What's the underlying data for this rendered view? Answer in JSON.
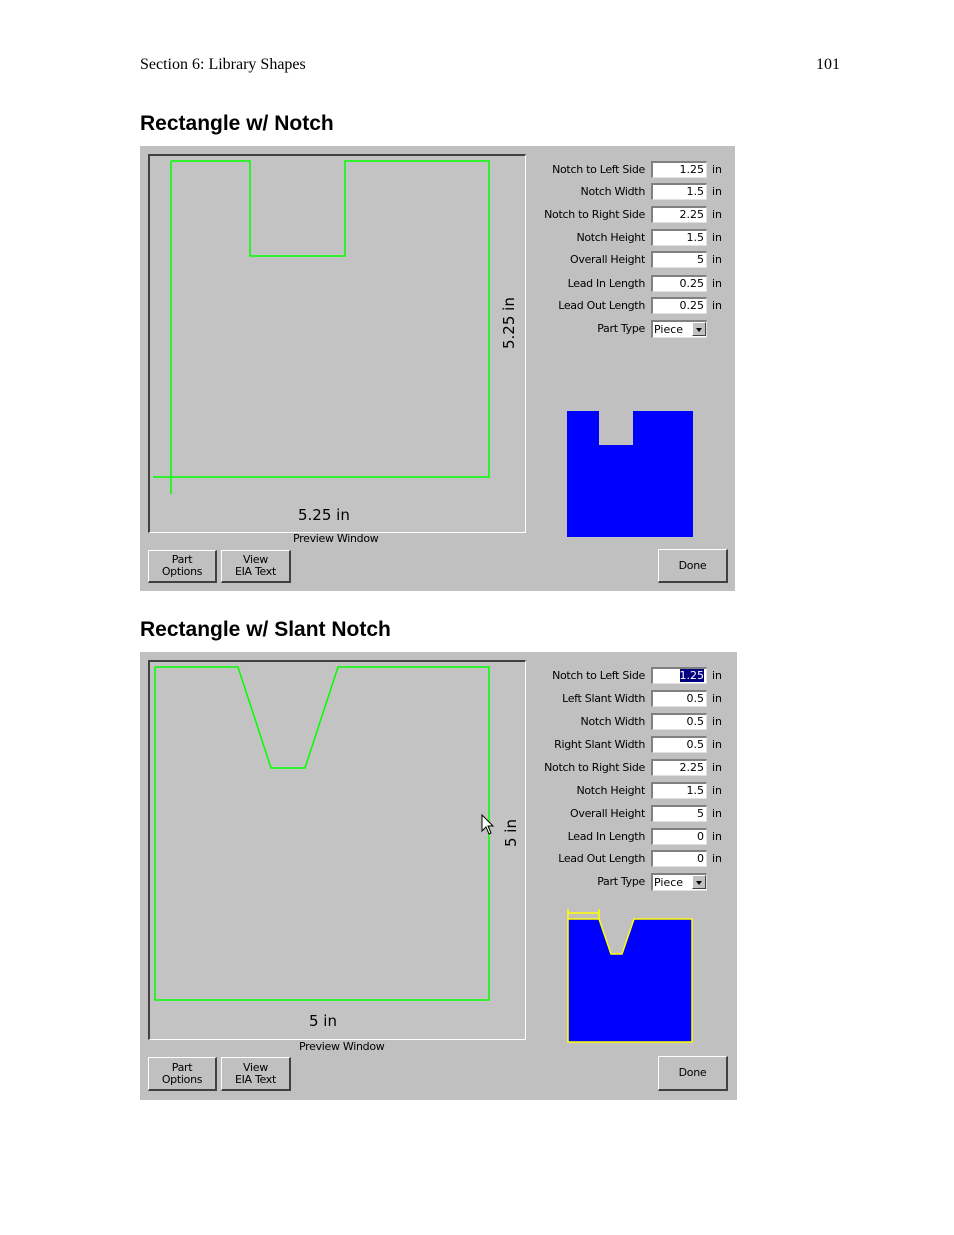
{
  "header": {
    "section": "Section 6: Library Shapes",
    "page_number": "101"
  },
  "dialogs": [
    {
      "title": "Rectangle w/ Notch",
      "preview": {
        "width_dim": "5.25 in",
        "height_dim": "5.25 in",
        "caption": "Preview Window"
      },
      "params": [
        {
          "label": "Notch to Left Side",
          "value": "1.25",
          "unit": "in"
        },
        {
          "label": "Notch Width",
          "value": "1.5",
          "unit": "in"
        },
        {
          "label": "Notch to Right Side",
          "value": "2.25",
          "unit": "in"
        },
        {
          "label": "Notch Height",
          "value": "1.5",
          "unit": "in"
        },
        {
          "label": "Overall Height",
          "value": "5",
          "unit": "in"
        },
        {
          "label": "Lead In Length",
          "value": "0.25",
          "unit": "in"
        },
        {
          "label": "Lead Out Length",
          "value": "0.25",
          "unit": "in"
        }
      ],
      "part_type": {
        "label": "Part Type",
        "value": "Piece"
      },
      "buttons": {
        "part_options": [
          "Part",
          "Options"
        ],
        "view_eia": [
          "View",
          "EIA Text"
        ],
        "done": "Done"
      },
      "colors": {
        "outline": "#00ff00",
        "thumbnail_fill": "#0000ff"
      }
    },
    {
      "title": "Rectangle w/ Slant Notch",
      "preview": {
        "width_dim": "5 in",
        "height_dim": "5 in",
        "caption": "Preview Window"
      },
      "params": [
        {
          "label": "Notch to Left Side",
          "value": "1.25",
          "unit": "in"
        },
        {
          "label": "Left Slant Width",
          "value": "0.5",
          "unit": "in"
        },
        {
          "label": "Notch Width",
          "value": "0.5",
          "unit": "in"
        },
        {
          "label": "Right Slant Width",
          "value": "0.5",
          "unit": "in"
        },
        {
          "label": "Notch to Right Side",
          "value": "2.25",
          "unit": "in"
        },
        {
          "label": "Notch Height",
          "value": "1.5",
          "unit": "in"
        },
        {
          "label": "Overall Height",
          "value": "5",
          "unit": "in"
        },
        {
          "label": "Lead In Length",
          "value": "0",
          "unit": "in"
        },
        {
          "label": "Lead Out Length",
          "value": "0",
          "unit": "in"
        }
      ],
      "part_type": {
        "label": "Part Type",
        "value": "Piece"
      },
      "buttons": {
        "part_options": [
          "Part",
          "Options"
        ],
        "view_eia": [
          "View",
          "EIA Text"
        ],
        "done": "Done"
      },
      "colors": {
        "outline": "#00ff00",
        "thumbnail_fill": "#0000ff",
        "thumbnail_highlight": "#ffff00"
      }
    }
  ]
}
